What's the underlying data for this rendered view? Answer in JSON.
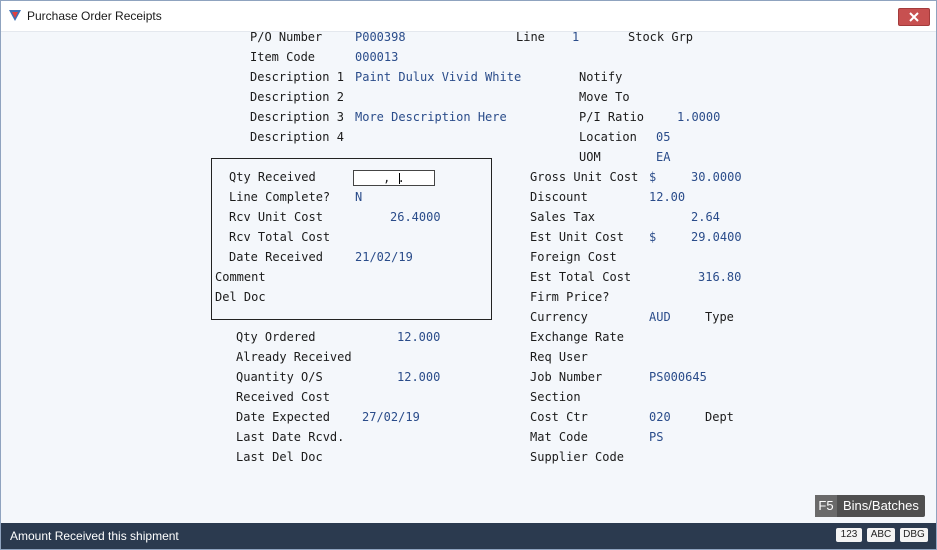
{
  "window": {
    "title": "Purchase Order Receipts",
    "close_symbol": "✕"
  },
  "header": {
    "po_number_label": "P/O Number",
    "po_number": "P000398",
    "line_label": "Line",
    "line": "1",
    "stock_grp_label": "Stock Grp",
    "item_code_label": "Item Code",
    "item_code": "000013",
    "desc1_label": "Description 1",
    "desc1": "Paint Dulux Vivid White",
    "desc2_label": "Description 2",
    "desc3_label": "Description 3",
    "desc3": "More Description Here",
    "desc4_label": "Description 4",
    "notify_label": "Notify",
    "move_to_label": "Move To",
    "pi_ratio_label": "P/I Ratio",
    "pi_ratio": "1.0000",
    "location_label": "Location",
    "location": "05",
    "uom_label": "UOM",
    "uom": "EA"
  },
  "receipt": {
    "qty_received_label": "Qty Received",
    "qty_received_mask": ",  .",
    "line_complete_label": "Line Complete?",
    "line_complete": "N",
    "rcv_unit_cost_label": "Rcv Unit Cost",
    "rcv_unit_cost": "26.4000",
    "rcv_total_cost_label": "Rcv Total Cost",
    "date_received_label": "Date Received",
    "date_received": "21/02/19",
    "comment_label": "Comment",
    "del_doc_label": "Del Doc"
  },
  "order": {
    "qty_ordered_label": "Qty Ordered",
    "qty_ordered": "12.000",
    "already_received_label": "Already Received",
    "qty_os_label": "Quantity O/S",
    "qty_os": "12.000",
    "received_cost_label": "Received Cost",
    "date_expected_label": "Date Expected",
    "date_expected": "27/02/19",
    "last_date_rcvd_label": "Last Date Rcvd.",
    "last_del_doc_label": "Last Del Doc"
  },
  "costs": {
    "gross_unit_cost_label": "Gross Unit Cost",
    "gross_unit_cost_currency": "$",
    "gross_unit_cost": "30.0000",
    "discount_label": "Discount",
    "discount": "12.00",
    "sales_tax_label": "Sales Tax",
    "sales_tax": "2.64",
    "est_unit_cost_label": "Est Unit Cost",
    "est_unit_cost_currency": "$",
    "est_unit_cost": "29.0400",
    "foreign_cost_label": "Foreign Cost",
    "est_total_cost_label": "Est Total Cost",
    "est_total_cost": "316.80",
    "firm_price_label": "Firm Price?",
    "currency_label": "Currency",
    "currency": "AUD",
    "type_label": "Type",
    "exchange_rate_label": "Exchange Rate",
    "req_user_label": "Req User",
    "job_number_label": "Job Number",
    "job_number": "PS000645",
    "section_label": "Section",
    "cost_ctr_label": "Cost Ctr",
    "cost_ctr": "020",
    "dept_label": "Dept",
    "mat_code_label": "Mat Code",
    "mat_code": "PS",
    "supplier_code_label": "Supplier Code"
  },
  "actions": {
    "f5_key": "F5",
    "f5_label": "Bins/Batches"
  },
  "status": {
    "message": "Amount Received this shipment",
    "indicators": [
      "123",
      "ABC",
      "DBG"
    ]
  },
  "colors": {
    "value_text": "#2a4c8a",
    "status_bar": "#2b3a4f",
    "close_button": "#c75050"
  }
}
